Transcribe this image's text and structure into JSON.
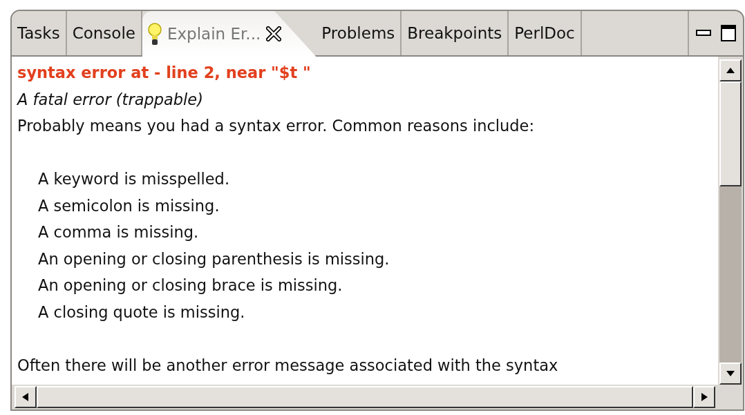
{
  "tabs": [
    {
      "label": "Tasks",
      "selected": false,
      "kind": "plain"
    },
    {
      "label": "Console",
      "selected": false,
      "kind": "plain"
    },
    {
      "label": "Explain Er...",
      "selected": true,
      "kind": "closable"
    },
    {
      "label": "Problems",
      "selected": false,
      "kind": "plain"
    },
    {
      "label": "Breakpoints",
      "selected": false,
      "kind": "plain"
    },
    {
      "label": "PerlDoc",
      "selected": false,
      "kind": "plain"
    }
  ],
  "content": [
    {
      "kind": "heading",
      "text": "syntax error at - line 2, near \"$t \""
    },
    {
      "kind": "summary",
      "text": "A fatal error (trappable)"
    },
    {
      "kind": "paragraph",
      "text": "Probably means you had a syntax error.  Common reasons include:"
    },
    {
      "kind": "list",
      "items": [
        "A keyword is misspelled.",
        "A semicolon is missing.",
        "A comma is missing.",
        "An opening or closing parenthesis is missing.",
        "An opening or closing brace is missing.",
        "A closing quote is missing."
      ]
    },
    {
      "kind": "paragraph",
      "text": "Often there will be another error message associated with the syntax"
    }
  ]
}
